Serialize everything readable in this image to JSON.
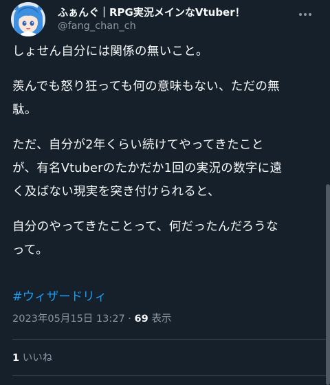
{
  "author": {
    "display_name": "ふぁんぐ｜RPG実況メインなVtuber！",
    "handle": "@fang_chan_ch"
  },
  "tweet": {
    "lines": [
      "しょせん自分には関係の無いこと。",
      "",
      "羨んでも怒り狂っても何の意味もない、ただの無",
      "駄。",
      "",
      "ただ、自分が2年くらい続けてやってきたこと",
      "が、有名Vtuberのたかだか1回の実況の数字に遠",
      "く及ばない現実を突き付けられると、",
      "",
      "自分のやってきたことって、何だったんだろうな",
      "って。"
    ],
    "hashtag": "#ウィザードリィ"
  },
  "meta": {
    "timestamp": "2023年05月15日 13:27",
    "separator": " · ",
    "views_count": "69",
    "views_label": " 表示"
  },
  "engagement": {
    "likes_count": "1",
    "likes_label": " いいね"
  },
  "icons": {
    "more": "more-horizontal-icon",
    "avatar": "avatar-image"
  },
  "colors": {
    "background": "#15202b",
    "text": "#f7f9f9",
    "secondary": "#8b98a5",
    "link": "#1d9bf0",
    "divider": "#38444d"
  }
}
